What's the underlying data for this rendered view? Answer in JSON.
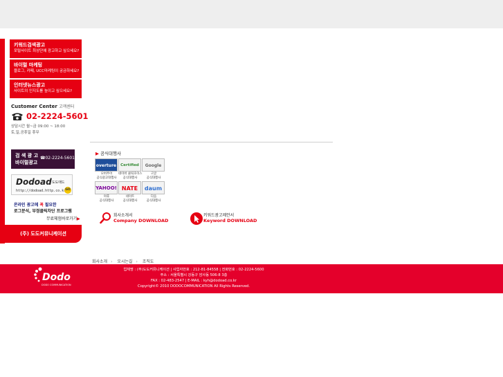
{
  "sidebar": {
    "menu": [
      {
        "title": "키워드검색광고",
        "desc": "포털사이트 최상단에 광고하고 싶으세요?"
      },
      {
        "title": "바이럴 마케팅",
        "desc": "블로그, 카페, UCC마케팅이 궁금하세요?"
      },
      {
        "title": "인터넷뉴스광고",
        "desc": "사이트의 인지도를 높이고 싶으세요?"
      }
    ],
    "customer_center": {
      "title_en": "Customer Center",
      "title_ko": "고객센터",
      "phone": "02-2224-5601",
      "hours_1": "상담시간 월~금 09:00 ~ 18:00",
      "hours_2": "토,일,공휴일 휴무"
    },
    "dark_box": {
      "line1": "검 색 광 고",
      "line2": "바이럴광고",
      "phone": "☎02-2224-5601"
    },
    "dodoad": {
      "logo": "Dodoad",
      "logo_ko": "도도애드",
      "url": "http://dodoad.http.co.kr",
      "go": "GO"
    },
    "promo": {
      "line1_a": "온라인 광고에 ",
      "line1_b": "꼭",
      "line1_c": " 필요한",
      "line2": "로그분석, 부정클릭차단 프로그램",
      "trial": "무료체험바로가기"
    },
    "company_button": "(주) 도도커뮤니케이션"
  },
  "main": {
    "section_title": "공식대행사",
    "partners": [
      {
        "logo": "overture",
        "caption1": "오버추어",
        "caption2": "공식광고대행사",
        "color": "#1f4e9a"
      },
      {
        "logo": "Certified",
        "caption1": "네이버 클릭초이스",
        "caption2": "공식대행사",
        "color": "#3a8d3a"
      },
      {
        "logo": "Google",
        "caption1": "구글",
        "caption2": "공식대행사",
        "color": "#666666"
      },
      {
        "logo": "YAHOO!",
        "caption1": "야후",
        "caption2": "공식대행사",
        "color": "#7b0099"
      },
      {
        "logo": "NATE",
        "caption1": "네이트",
        "caption2": "공식대행사",
        "color": "#e60012"
      },
      {
        "logo": "daum",
        "caption1": "다음",
        "caption2": "공식대행사",
        "color": "#2f6fd0"
      }
    ],
    "downloads": [
      {
        "top": "회사소개서",
        "bottom": "Company DOWNLOAD"
      },
      {
        "top": "키워드광고제안서",
        "bottom": "Keyword DOWNLOAD"
      }
    ]
  },
  "footer": {
    "links": [
      "회사소개",
      "오시는길",
      "조직도"
    ],
    "logo_text": "Dodo",
    "logo_sub": "DODO COMMUNICATION",
    "line1": "업체명 : (주)도도커뮤니케이션  |  사업자번호 : 212-81-84558  |  전화번호 : 02-2224-5600",
    "line2": "주소 : 서울특별시 강동구 암사동 506-8 3층",
    "line3": "FAX : 02-483-2547 | E-MAIL : kyh@dodoad.co.kr",
    "line4": "Copyright© 2010 DODOCOMMUNICATION All Rights Reserved."
  },
  "colors": {
    "brand_red": "#e60012",
    "dark_purple": "#3a1136",
    "top_bar": "#eeeeee"
  }
}
